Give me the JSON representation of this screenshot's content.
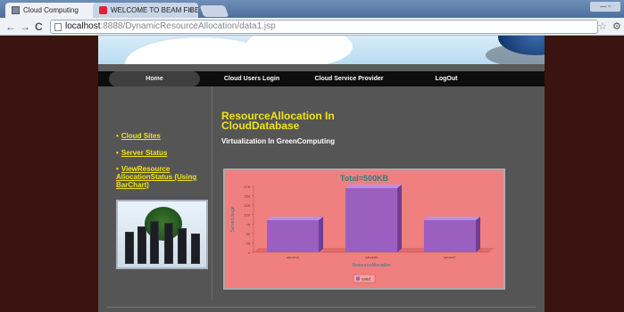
{
  "browser": {
    "tabs": [
      {
        "label": "Cloud Computing",
        "active": true
      },
      {
        "label": "WELCOME TO BEAM FIBER",
        "active": false
      }
    ],
    "url_host": "localhost",
    "url_rest": ":8888/DynamicResourceAllocation/data1.jsp"
  },
  "nav": {
    "items": [
      "Home",
      "Cloud Users Login",
      "Cloud Service Provider",
      "LogOut"
    ]
  },
  "sidebar": {
    "links": [
      "Cloud Sites",
      "Server Status",
      "ViewResource AllocationStatus (Using BarChart)"
    ]
  },
  "main": {
    "title": "ResourceAllocation In CloudDatabase",
    "subtitle": "Virtualization In GreenComputing"
  },
  "colors": {
    "accent_yellow": "#f2e21a",
    "chart_bg": "#f08080",
    "bar_color": "#9b5fc0"
  },
  "chart_data": {
    "type": "bar",
    "title": "Total=500KB",
    "categories": [
      "serverA",
      "serverB",
      "serverC"
    ],
    "series": [
      {
        "name": "used",
        "values": [
          85,
          170,
          85
        ]
      }
    ],
    "xlabel": "ResourceAllocation",
    "ylabel": "ServerUsage",
    "ylim": [
      0,
      175
    ],
    "yticks": [
      0,
      25,
      50,
      75,
      100,
      125,
      150,
      175
    ],
    "legend": "bottom"
  }
}
